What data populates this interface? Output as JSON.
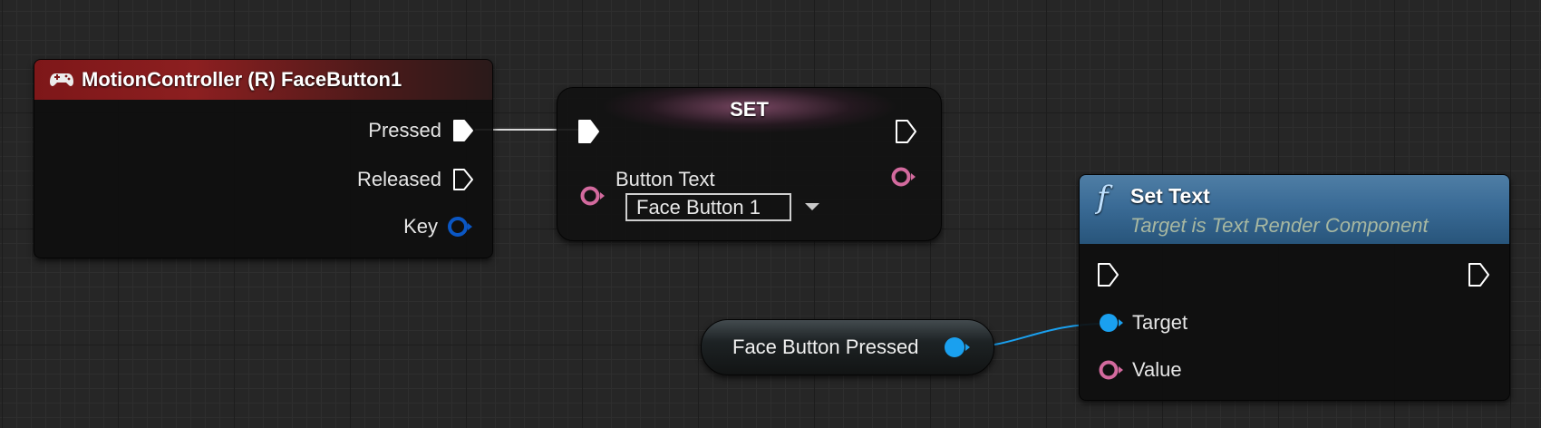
{
  "event_node": {
    "icon": "gamepad-icon",
    "title": "MotionController (R) FaceButton1",
    "header_color": "#8c1f20",
    "pins": {
      "pressed": "Pressed",
      "released": "Released",
      "key": "Key"
    }
  },
  "set_node": {
    "title": "SET",
    "input_label": "Button Text",
    "input_value": "Face Button 1",
    "pin_color": "#d36a9e"
  },
  "function_node": {
    "icon": "function-icon",
    "glyph": "f",
    "title": "Set Text",
    "subtitle": "Target is Text Render Component",
    "header_color": "#3a6b96",
    "pins": {
      "target": "Target",
      "value": "Value"
    }
  },
  "variable_node": {
    "label": "Face Button Pressed",
    "pin_color": "#1aa0ef"
  },
  "colors": {
    "exec": "#ffffff",
    "struct_key": "#0b57c4",
    "text": "#d36a9e",
    "object": "#1aa0ef"
  }
}
